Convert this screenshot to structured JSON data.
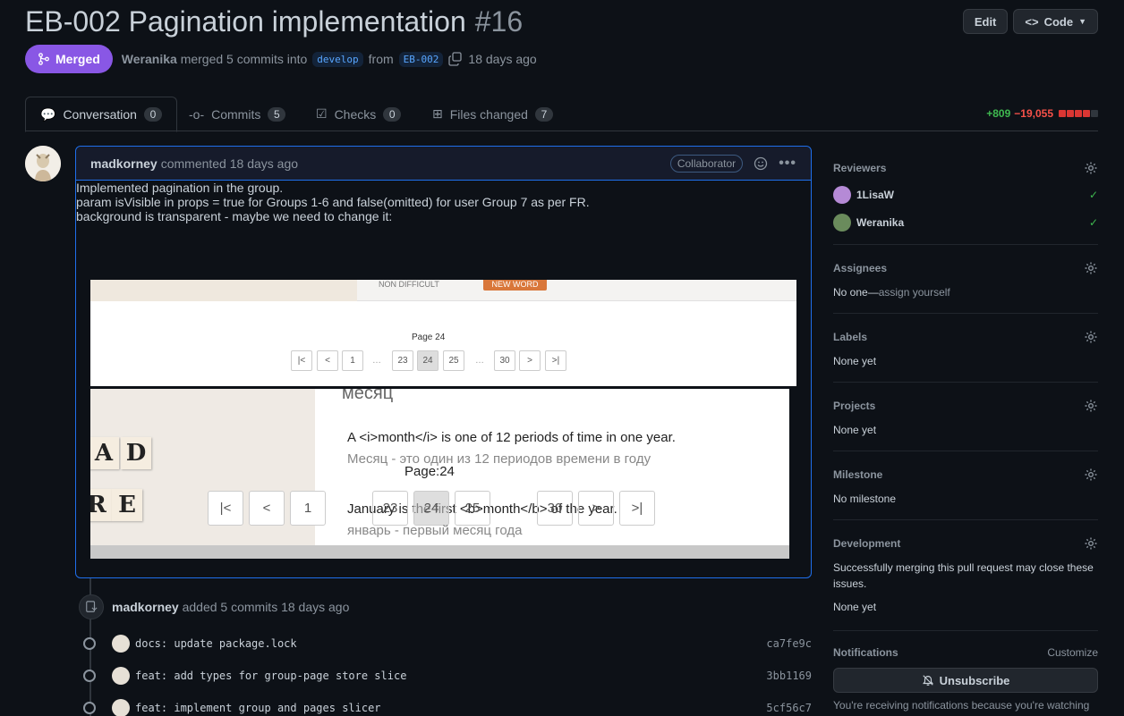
{
  "pr": {
    "title": "EB-002 Pagination implementation",
    "number": "#16",
    "edit_label": "Edit",
    "code_label": "Code",
    "status": "Merged",
    "merger": "Weranika",
    "merged_text": "merged 5 commits into",
    "base_branch": "develop",
    "from_text": "from",
    "head_branch": "EB-002",
    "time": "18 days ago"
  },
  "tabs": [
    {
      "label": "Conversation",
      "count": "0"
    },
    {
      "label": "Commits",
      "count": "5"
    },
    {
      "label": "Checks",
      "count": "0"
    },
    {
      "label": "Files changed",
      "count": "7"
    }
  ],
  "diffstat": {
    "additions": "+809",
    "deletions": "−19,055"
  },
  "comment": {
    "author": "madkorney",
    "action": "commented 18 days ago",
    "badge": "Collaborator",
    "line1": "Implemented pagination in the group.",
    "line2": "param isVisible in props = true for Groups 1-6 and false(omitted) for user Group 7 as per FR.",
    "line3": "background is transparent - maybe we need to change it:"
  },
  "shot1": {
    "non_difficult": "NON DIFFICULT",
    "new_word": "NEW WORD",
    "page_label": "Page 24",
    "buttons": [
      "|<",
      "<",
      "1",
      "23",
      "24",
      "25",
      "30",
      ">",
      ">|"
    ]
  },
  "shot2": {
    "word": "месяц",
    "example_en": "A <i>month</i> is one of 12 periods of time in one year.",
    "example_ru": "Месяц - это один из 12 периодов времени в году",
    "page_label": "Page:24",
    "buttons": [
      "|<",
      "<",
      "1",
      "23",
      "24",
      "25",
      "30",
      ">",
      ">|"
    ],
    "example_en2": "January is the first <b>month</b> of the year.",
    "example_ru2": "январь - первый месяц года",
    "tiles": [
      "A",
      "D",
      "R",
      "E"
    ]
  },
  "timeline": {
    "author": "madkorney",
    "action": "added 5 commits 18 days ago",
    "commits": [
      {
        "message": "docs: update package.lock",
        "sha": "ca7fe9c"
      },
      {
        "message": "feat: add types for group-page store slice",
        "sha": "3bb1169"
      },
      {
        "message": "feat: implement group and pages slicer",
        "sha": "5cf56c7"
      }
    ]
  },
  "sidebar": {
    "reviewers_title": "Reviewers",
    "reviewers": [
      {
        "name": "1LisaW",
        "color": "#b58ad6"
      },
      {
        "name": "Weranika",
        "color": "#6a8b5c"
      }
    ],
    "assignees_title": "Assignees",
    "assignees_none": "No one—",
    "assign_yourself": "assign yourself",
    "labels_title": "Labels",
    "labels_value": "None yet",
    "projects_title": "Projects",
    "projects_value": "None yet",
    "milestone_title": "Milestone",
    "milestone_value": "No milestone",
    "development_title": "Development",
    "development_text": "Successfully merging this pull request may close these issues.",
    "development_value": "None yet",
    "notifications_title": "Notifications",
    "customize": "Customize",
    "unsubscribe": "Unsubscribe",
    "watching_text": "You're receiving notifications because you're watching"
  },
  "colors": {
    "merged": "#8957e5",
    "accent": "#1f6feb",
    "add": "#3fb950",
    "del": "#f85149"
  }
}
